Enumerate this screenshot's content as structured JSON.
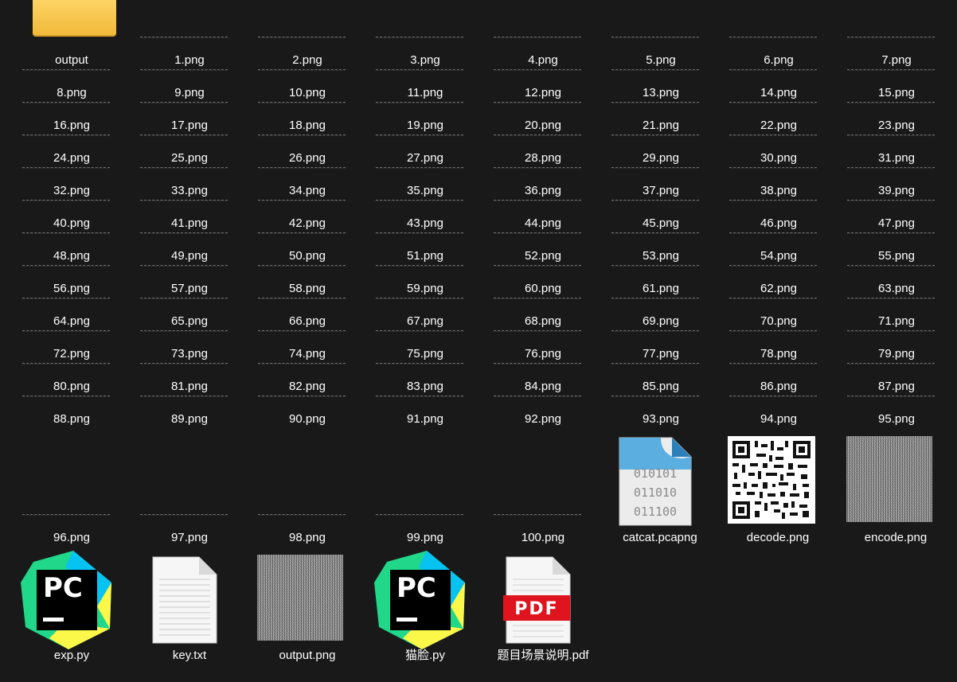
{
  "folder": {
    "name": "output"
  },
  "png_sequence": [
    "1.png",
    "2.png",
    "3.png",
    "4.png",
    "5.png",
    "6.png",
    "7.png",
    "8.png",
    "9.png",
    "10.png",
    "11.png",
    "12.png",
    "13.png",
    "14.png",
    "15.png",
    "16.png",
    "17.png",
    "18.png",
    "19.png",
    "20.png",
    "21.png",
    "22.png",
    "23.png",
    "24.png",
    "25.png",
    "26.png",
    "27.png",
    "28.png",
    "29.png",
    "30.png",
    "31.png",
    "32.png",
    "33.png",
    "34.png",
    "35.png",
    "36.png",
    "37.png",
    "38.png",
    "39.png",
    "40.png",
    "41.png",
    "42.png",
    "43.png",
    "44.png",
    "45.png",
    "46.png",
    "47.png",
    "48.png",
    "49.png",
    "50.png",
    "51.png",
    "52.png",
    "53.png",
    "54.png",
    "55.png",
    "56.png",
    "57.png",
    "58.png",
    "59.png",
    "60.png",
    "61.png",
    "62.png",
    "63.png",
    "64.png",
    "65.png",
    "66.png",
    "67.png",
    "68.png",
    "69.png",
    "70.png",
    "71.png",
    "72.png",
    "73.png",
    "74.png",
    "75.png",
    "76.png",
    "77.png",
    "78.png",
    "79.png",
    "80.png",
    "81.png",
    "82.png",
    "83.png",
    "84.png",
    "85.png",
    "86.png",
    "87.png",
    "88.png",
    "89.png",
    "90.png",
    "91.png",
    "92.png",
    "93.png",
    "94.png",
    "95.png",
    "96.png",
    "97.png",
    "98.png",
    "99.png",
    "100.png"
  ],
  "other_files": {
    "pcapng": {
      "name": "catcat.pcapng",
      "icon": "binary-file-icon",
      "icon_lines": [
        "010101",
        "011010",
        "011100"
      ],
      "icon_color": "#5aaee0"
    },
    "decode": {
      "name": "decode.png",
      "icon": "qr-code-thumbnail"
    },
    "encode": {
      "name": "encode.png",
      "icon": "noise-image-thumbnail"
    },
    "exp": {
      "name": "exp.py",
      "icon": "pycharm-icon",
      "icon_text": "PC"
    },
    "key": {
      "name": "key.txt",
      "icon": "text-document-icon"
    },
    "output_png": {
      "name": "output.png",
      "icon": "noise-image-thumbnail"
    },
    "maolian": {
      "name": "猫脸.py",
      "icon": "pycharm-icon",
      "icon_text": "PC"
    },
    "pdf": {
      "name": "题目场景说明.pdf",
      "icon": "pdf-document-icon",
      "icon_text": "PDF",
      "icon_color": "#e0141e"
    }
  }
}
